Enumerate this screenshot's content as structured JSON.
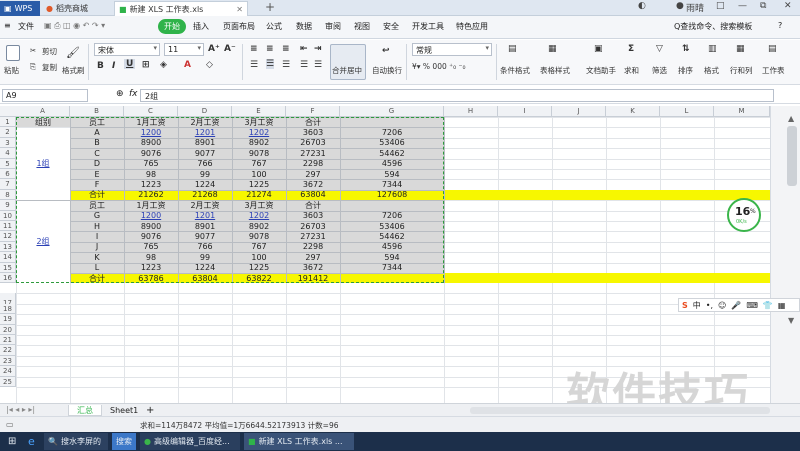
{
  "titlebar": {
    "app_tab": "WPS",
    "tabs": [
      "稻壳商城",
      "新建 XLS 工作表.xls"
    ],
    "new_tab": "+",
    "user": "雨晴",
    "win_buttons": [
      "□",
      "—",
      "⧉",
      "✕"
    ]
  },
  "menubar": {
    "file": "文件",
    "items": [
      "开始",
      "插入",
      "页面布局",
      "公式",
      "数据",
      "审阅",
      "视图",
      "安全",
      "开发工具",
      "特色应用"
    ],
    "search": "Q查找命令、搜索模板"
  },
  "ribbon": {
    "paste": "粘贴",
    "cut": "剪切",
    "copy": "复制",
    "format_painter": "格式刷",
    "font_name": "宋体",
    "font_size": "11",
    "bold": "B",
    "italic": "I",
    "underline": "U",
    "merge_center": "合并居中",
    "wrap_text": "自动换行",
    "number_format": "常规",
    "conditional_format": "条件格式",
    "table_style": "表格样式",
    "doc_helper": "文档助手",
    "sum": "求和",
    "filter": "筛选",
    "sort": "排序",
    "format": "格式",
    "row_col": "行和列",
    "worksheet": "工作表"
  },
  "formula_bar": {
    "name_box": "A9",
    "fx": "fx",
    "content": "2组"
  },
  "columns": [
    "A",
    "B",
    "C",
    "D",
    "E",
    "F",
    "G",
    "H",
    "I",
    "J",
    "K",
    "L",
    "M"
  ],
  "rows": [
    "1",
    "2",
    "3",
    "4",
    "5",
    "6",
    "7",
    "8",
    "9",
    "10",
    "11",
    "12",
    "13",
    "14",
    "15",
    "16",
    "17",
    "18",
    "19",
    "20",
    "21",
    "22",
    "23",
    "24",
    "25"
  ],
  "group1": {
    "label": "组别",
    "group_name": "1组",
    "header": [
      "员工",
      "1月工资",
      "2月工资",
      "3月工资",
      "合计"
    ],
    "rows": [
      [
        "A",
        "1200",
        "1201",
        "1202",
        "3603",
        "7206"
      ],
      [
        "B",
        "8900",
        "8901",
        "8902",
        "26703",
        "53406"
      ],
      [
        "C",
        "9076",
        "9077",
        "9078",
        "27231",
        "54462"
      ],
      [
        "D",
        "765",
        "766",
        "767",
        "2298",
        "4596"
      ],
      [
        "E",
        "98",
        "99",
        "100",
        "297",
        "594"
      ],
      [
        "F",
        "1223",
        "1224",
        "1225",
        "3672",
        "7344"
      ]
    ],
    "total": [
      "合计",
      "21262",
      "21268",
      "21274",
      "63804",
      "127608"
    ]
  },
  "group2": {
    "group_name": "2组",
    "header": [
      "员工",
      "1月工资",
      "2月工资",
      "3月工资",
      "合计"
    ],
    "rows": [
      [
        "G",
        "1200",
        "1201",
        "1202",
        "3603",
        "7206"
      ],
      [
        "H",
        "8900",
        "8901",
        "8902",
        "26703",
        "53406"
      ],
      [
        "I",
        "9076",
        "9077",
        "9078",
        "27231",
        "54462"
      ],
      [
        "J",
        "765",
        "766",
        "767",
        "2298",
        "4596"
      ],
      [
        "K",
        "98",
        "99",
        "100",
        "297",
        "594"
      ],
      [
        "L",
        "1223",
        "1224",
        "1225",
        "3672",
        "7344"
      ]
    ],
    "total": [
      "合计",
      "63786",
      "63804",
      "63822",
      "191412",
      ""
    ]
  },
  "sheet_tabs": [
    "汇总",
    "Sheet1"
  ],
  "add_sheet": "+",
  "status": "求和=114万8472  平均值=1万6644.52173913  计数=96",
  "speed": {
    "percent": "16",
    "unit": "%",
    "rate": "0K/s"
  },
  "ime": {
    "lang": "中"
  },
  "watermark": "软件技巧",
  "taskbar": {
    "search": "搜水李屏的",
    "search_btn": "搜索",
    "items": [
      "高级编辑器_百度经...",
      "新建 XLS 工作表.xls ..."
    ]
  },
  "colors": {
    "highlight": "#f7f700",
    "selection": "#d9d9d9",
    "accent": "#2fb34a",
    "link": "#2a3fb5"
  }
}
